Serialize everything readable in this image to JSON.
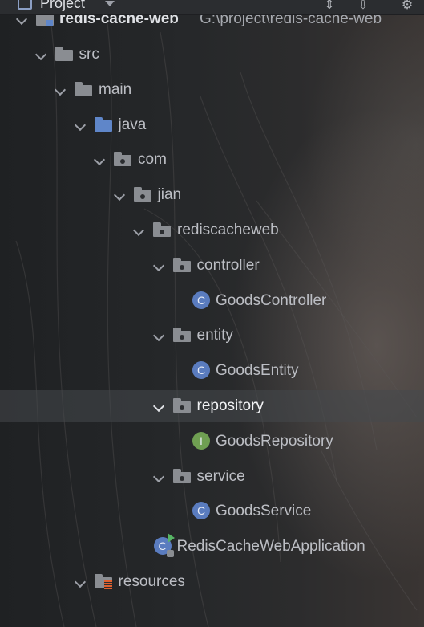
{
  "panel": {
    "title": "Project",
    "title_icon": "project-window-icon",
    "toolbar": [
      {
        "name": "expand-all-icon"
      },
      {
        "name": "collapse-all-icon"
      },
      {
        "name": "gear-icon"
      }
    ]
  },
  "tree": {
    "root": {
      "label": "redis-cache-web",
      "path": "G:\\project\\redis-cache-web",
      "icon": "module-folder-icon"
    },
    "nodes": [
      {
        "label": "src",
        "icon": "folder-icon"
      },
      {
        "label": "main",
        "icon": "folder-icon"
      },
      {
        "label": "java",
        "icon": "source-root-folder-icon"
      },
      {
        "label": "com",
        "icon": "package-icon"
      },
      {
        "label": "jian",
        "icon": "package-icon"
      },
      {
        "label": "rediscacheweb",
        "icon": "package-icon"
      },
      {
        "label": "controller",
        "icon": "package-icon"
      },
      {
        "label": "GoodsController",
        "icon": "class-icon",
        "glyph": "C"
      },
      {
        "label": "entity",
        "icon": "package-icon"
      },
      {
        "label": "GoodsEntity",
        "icon": "class-icon",
        "glyph": "C"
      },
      {
        "label": "repository",
        "icon": "package-icon",
        "selected": true
      },
      {
        "label": "GoodsRepository",
        "icon": "interface-icon",
        "glyph": "I"
      },
      {
        "label": "service",
        "icon": "package-icon"
      },
      {
        "label": "GoodsService",
        "icon": "class-icon",
        "glyph": "C"
      },
      {
        "label": "RedisCacheWebApplication",
        "icon": "spring-boot-application-icon",
        "glyph": "C"
      },
      {
        "label": "resources",
        "icon": "resources-folder-icon"
      }
    ]
  },
  "colors": {
    "folder": "#8a8d92",
    "source_root": "#5f86c9",
    "class_icon": "#5a7cbf",
    "interface_icon": "#6f9f52",
    "selection": "#46484c"
  }
}
